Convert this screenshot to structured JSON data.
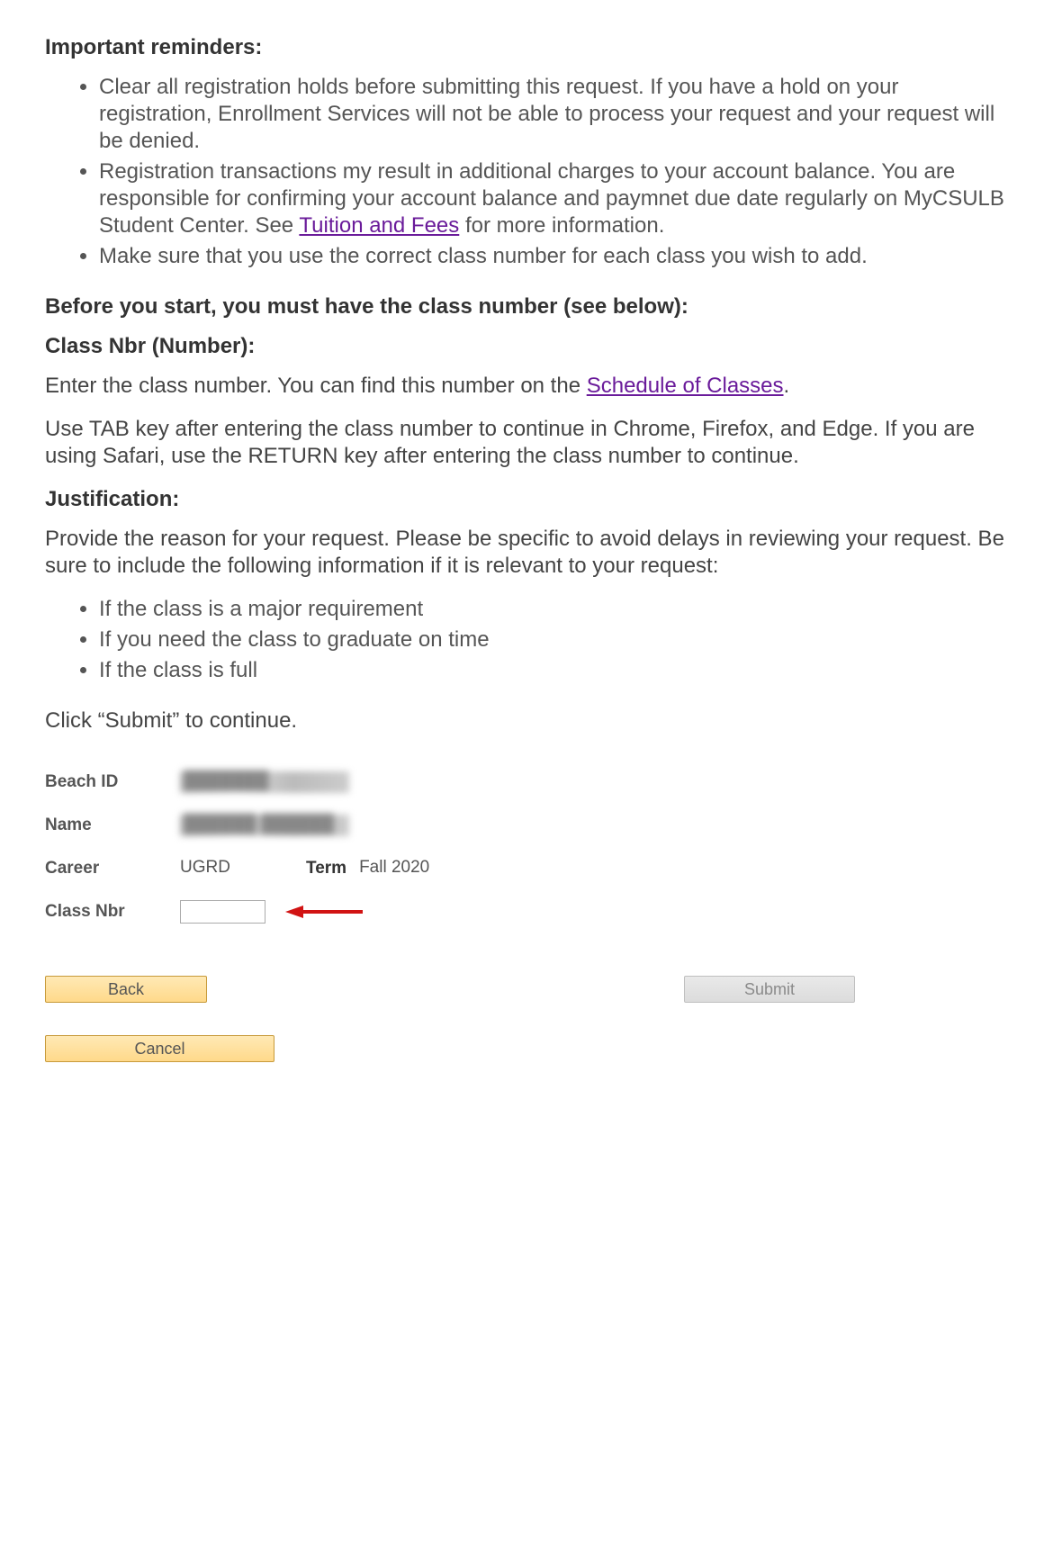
{
  "headings": {
    "important_reminders": "Important reminders:",
    "before_start": "Before you start, you must have the class number (see below):",
    "class_nbr": "Class Nbr (Number):",
    "justification": "Justification:"
  },
  "reminders": {
    "item1": "Clear all registration holds before submitting this request. If you have a hold on your registration, Enrollment Services will not be able to process your request and your request will be denied.",
    "item2_pre": "Registration transactions my result in additional charges to your account balance. You are responsible for confirming your account balance and paymnet due date regularly on MyCSULB Student Center. See ",
    "item2_link": "Tuition and Fees",
    "item2_post": " for more information.",
    "item3": "Make sure that you use the correct class number for each class you wish to add."
  },
  "class_nbr_section": {
    "intro_pre": "Enter the class number. You can find this number on the ",
    "intro_link": "Schedule of Classes",
    "intro_post": ".",
    "tab_note": "Use TAB key after entering the class number to continue in Chrome, Firefox, and Edge. If you are using Safari, use the RETURN key after entering the class number to continue."
  },
  "justification_section": {
    "intro": "Provide the reason for your request. Please be specific to avoid delays in reviewing your request. Be sure to include the following information if it is relevant to your request:",
    "bullet1": "If the class is a major requirement",
    "bullet2": "If you need the class to graduate on time",
    "bullet3": "If the class is full",
    "submit_note": "Click “Submit” to continue."
  },
  "form": {
    "beach_id_label": "Beach ID",
    "beach_id_value": "███████",
    "name_label": "Name",
    "name_value": "██████ ██████",
    "career_label": "Career",
    "career_value": "UGRD",
    "term_label": "Term",
    "term_value": "Fall 2020",
    "class_nbr_label": "Class Nbr",
    "class_nbr_value": ""
  },
  "buttons": {
    "back": "Back",
    "submit": "Submit",
    "cancel": "Cancel"
  },
  "colors": {
    "link": "#6a1b9a",
    "button_bg_top": "#ffe9b5",
    "button_bg_bottom": "#ffd98a",
    "button_border": "#c79a3a",
    "submit_bg": "#e0e0e0",
    "arrow": "#d11313"
  }
}
